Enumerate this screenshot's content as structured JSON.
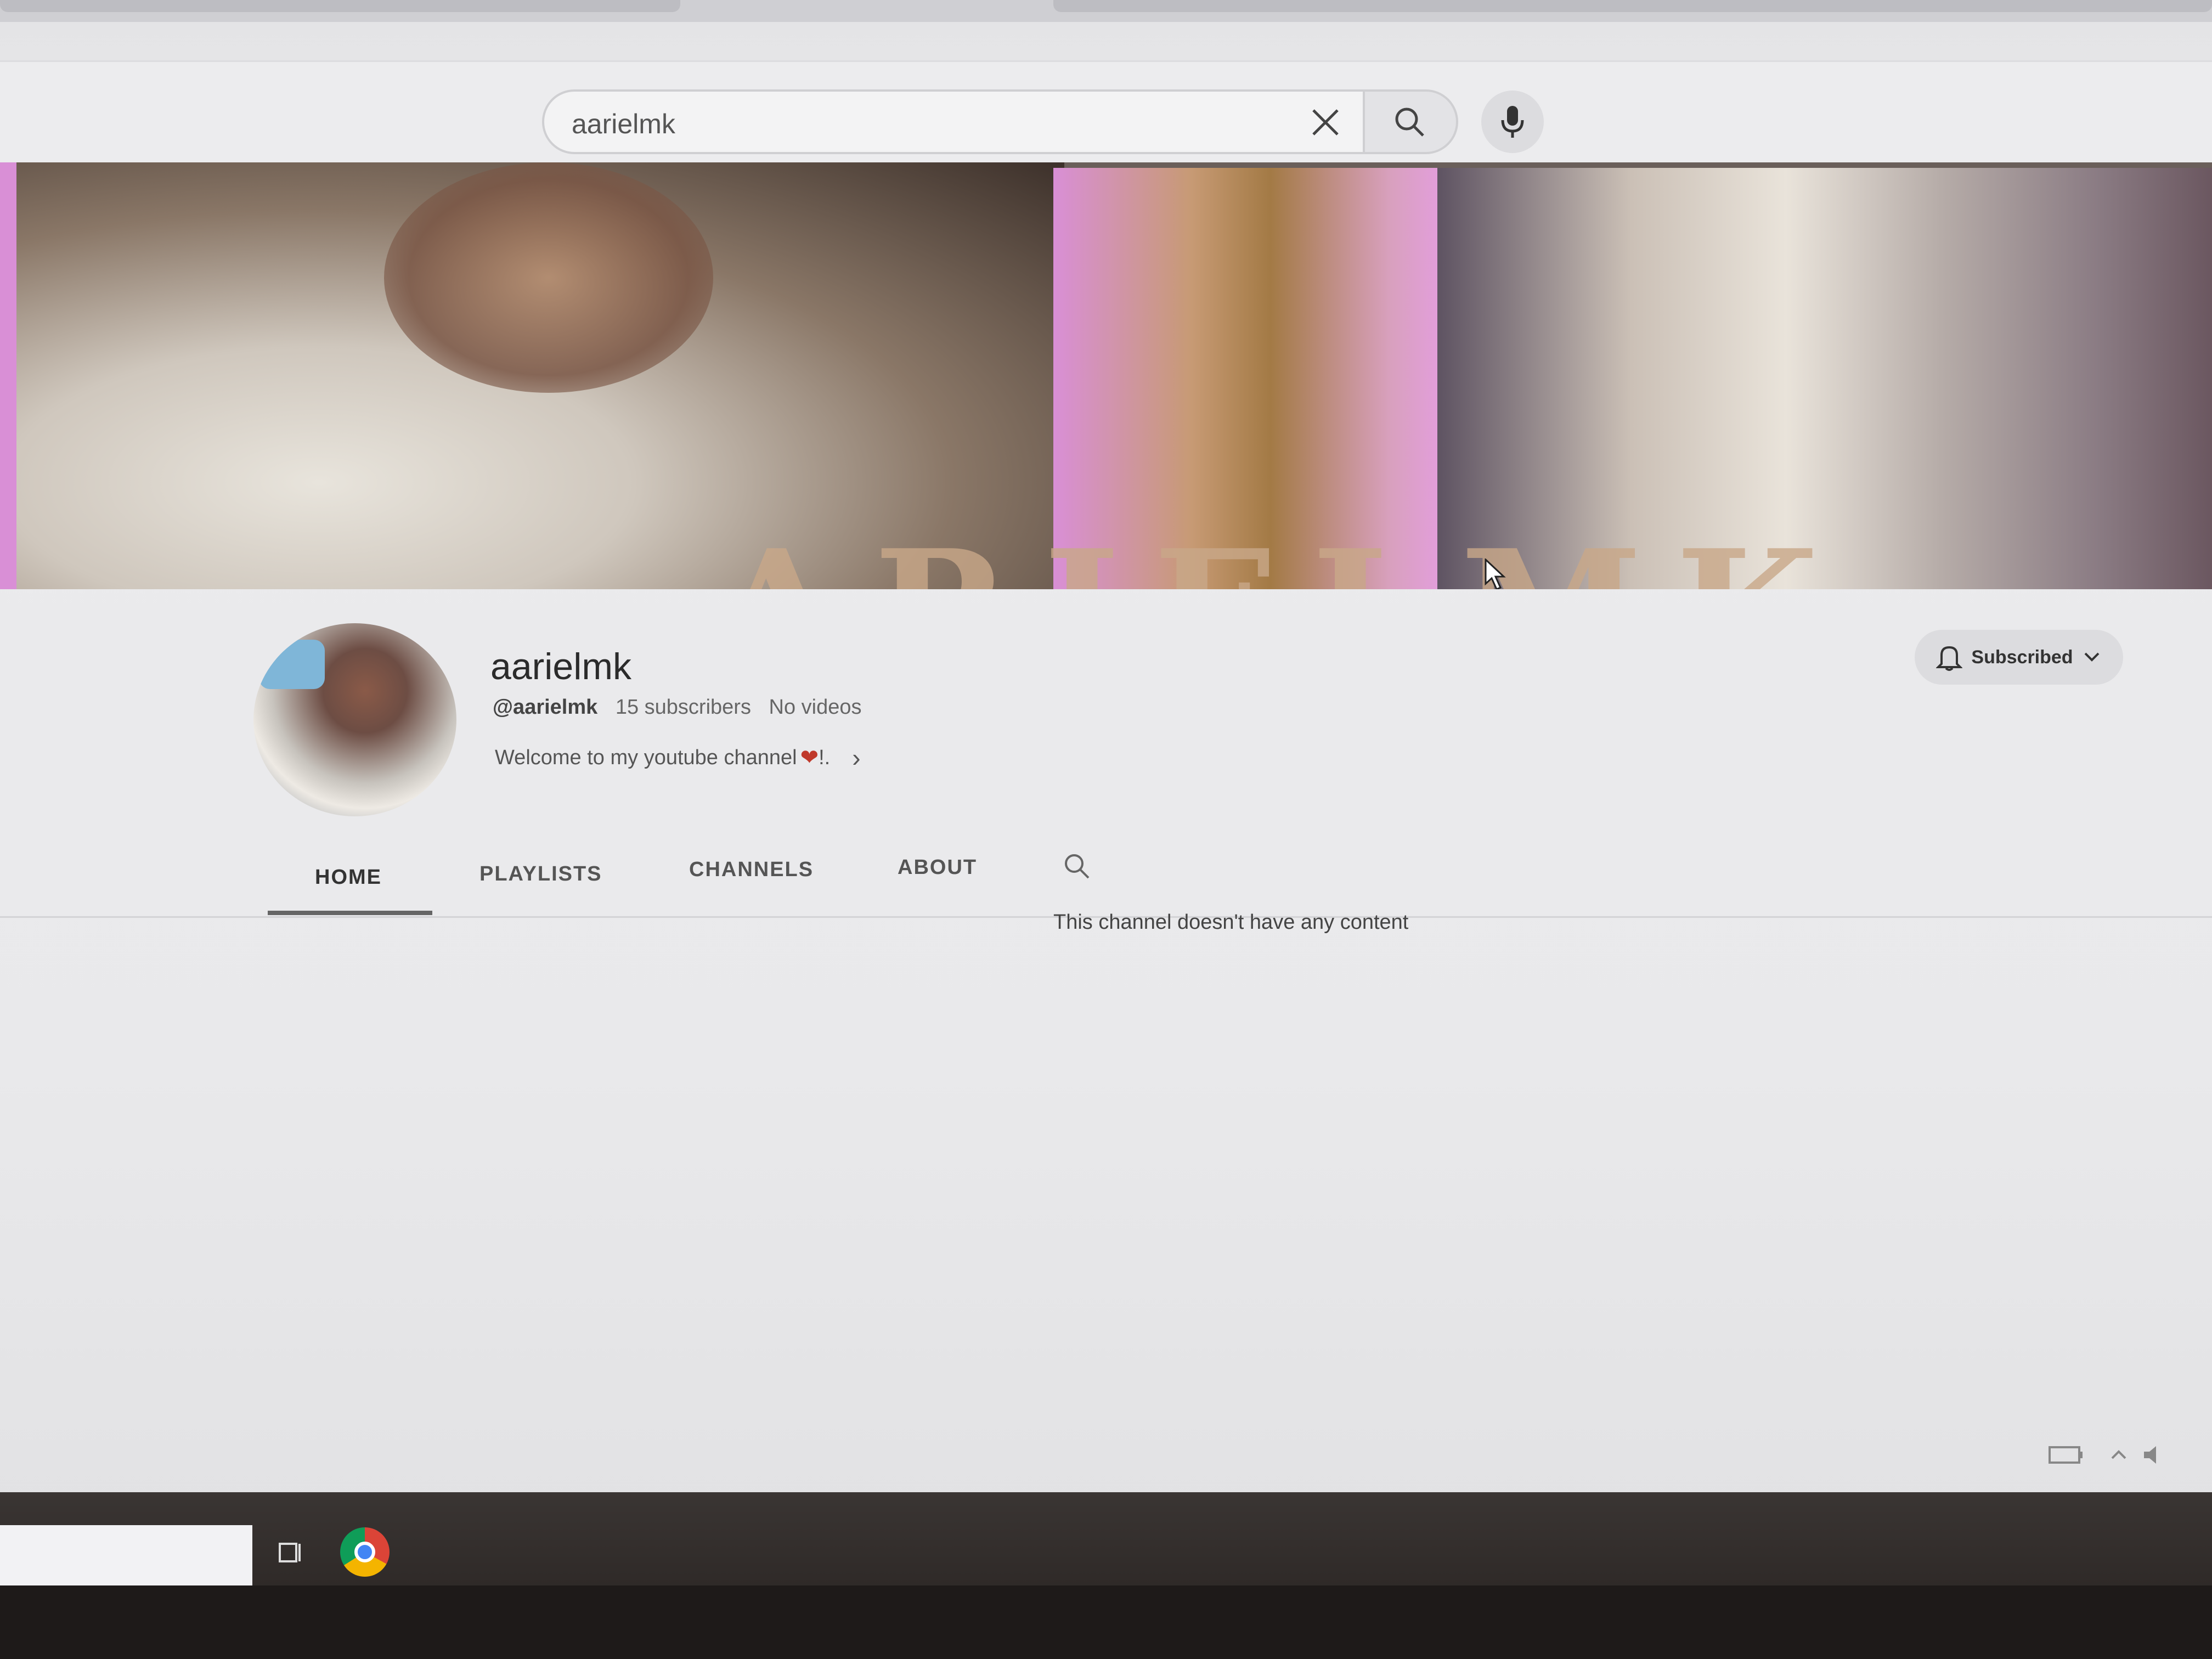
{
  "search": {
    "query": "aarielmk"
  },
  "banner": {
    "overlay_text": "ARIELMK"
  },
  "channel": {
    "name": "aarielmk",
    "handle": "@aarielmk",
    "subscribers": "15 subscribers",
    "videos": "No videos",
    "description": "Welcome to my youtube channel",
    "description_suffix": "!.",
    "subscribe_label": "Subscribed"
  },
  "tabs": [
    {
      "label": "HOME",
      "active": true
    },
    {
      "label": "PLAYLISTS",
      "active": false
    },
    {
      "label": "CHANNELS",
      "active": false
    },
    {
      "label": "ABOUT",
      "active": false
    }
  ],
  "content": {
    "empty_message": "This channel doesn't have any content"
  },
  "icons": {
    "clear": "close-icon",
    "search": "search-icon",
    "mic": "mic-icon",
    "bell": "bell-icon",
    "chevron": "chevron-down-icon",
    "desc_more": "chevron-right-icon",
    "heart": "heart-icon"
  },
  "colors": {
    "banner_pink": "#d98fd6",
    "background": "#e9e9eb",
    "heart": "#c0392b"
  }
}
